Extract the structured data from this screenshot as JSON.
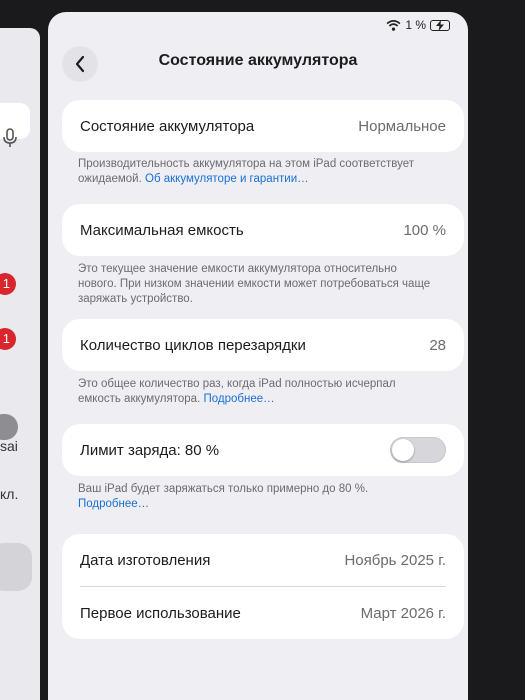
{
  "status_bar": {
    "battery_percent": "1 %"
  },
  "sidebar": {
    "badges": [
      "1",
      "1"
    ],
    "texts": [
      "sai",
      "кл."
    ]
  },
  "nav": {
    "title": "Состояние аккумулятора"
  },
  "battery_health": {
    "label": "Состояние аккумулятора",
    "value": "Нормальное",
    "note": "Производительность аккумулятора на этом iPad соответствует ожидаемой.",
    "link": "Об аккумуляторе и гарантии…"
  },
  "max_capacity": {
    "label": "Максимальная емкость",
    "value": "100 %",
    "note": "Это текущее значение емкости аккумулятора относительно нового. При низком значении емкости может потребоваться чаще заряжать устройство."
  },
  "cycle_count": {
    "label": "Количество циклов перезарядки",
    "value": "28",
    "note": "Это общее количество раз, когда iPad полностью исчерпал емкость аккумулятора.",
    "link": "Подробнее…"
  },
  "charge_limit": {
    "label": "Лимит заряда: 80 %",
    "enabled": false,
    "note": "Ваш iPad будет заряжаться только примерно до 80 %.",
    "link": "Подробнее…"
  },
  "dates": {
    "manufacture_label": "Дата изготовления",
    "manufacture_value": "Ноябрь 2025 г.",
    "first_use_label": "Первое использование",
    "first_use_value": "Март 2026 г."
  },
  "colors": {
    "link": "#1a6fd6",
    "badge": "#d8262c",
    "panel_bg": "#efeff3"
  }
}
